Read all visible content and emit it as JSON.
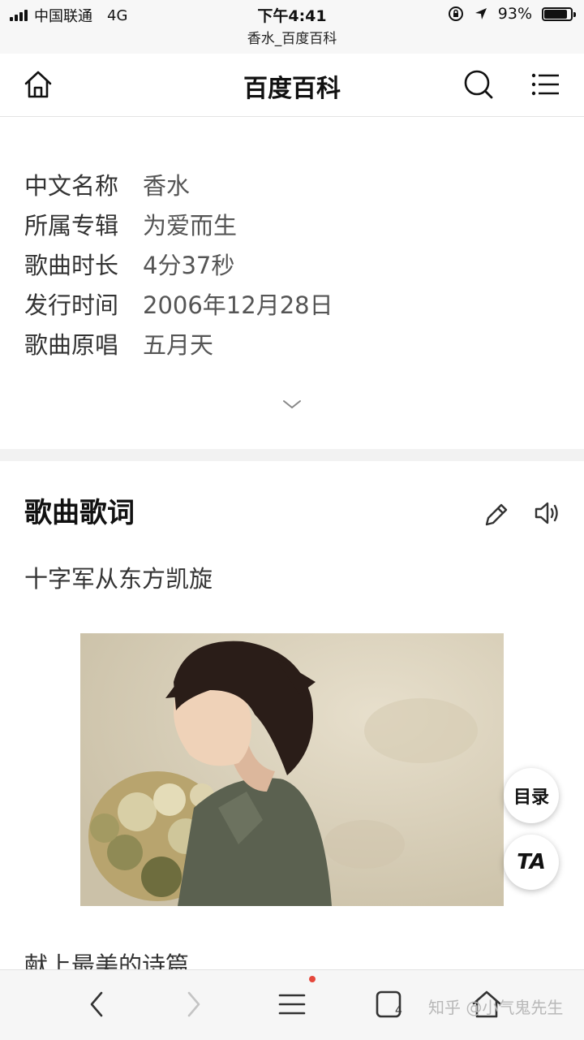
{
  "status_bar": {
    "carrier": "中国联通",
    "network": "4G",
    "time": "下午4:41",
    "page_subtitle": "香水_百度百科",
    "battery": "93%",
    "battery_level": 0.93
  },
  "header": {
    "home_icon": "home-icon",
    "title": "百度百科",
    "search_icon": "search-icon",
    "menu_icon": "menu-icon"
  },
  "info": {
    "rows": [
      {
        "label": "中文名称",
        "value": "香水"
      },
      {
        "label": "所属专辑",
        "value": "为爱而生"
      },
      {
        "label": "歌曲时长",
        "value": "4分37秒"
      },
      {
        "label": "发行时间",
        "value": "2006年12月28日"
      },
      {
        "label": "歌曲原唱",
        "value": "五月天"
      }
    ],
    "expand_icon": "chevron-down-icon"
  },
  "lyrics_section": {
    "title": "歌曲歌词",
    "edit_icon": "pencil-icon",
    "audio_icon": "speaker-icon",
    "line1": "十字军从东方凯旋",
    "line2": "献上最美的诗篇"
  },
  "floating": {
    "toc_label": "目录",
    "ta_label": "TA"
  },
  "toolbar": {
    "back_icon": "chevron-left-icon",
    "forward_icon": "chevron-right-icon",
    "menu_icon": "menu-icon",
    "tabs_icon": "tabs-icon",
    "tab_count": "4",
    "home_icon": "home-icon",
    "watermark": "知乎 @小气鬼先生"
  },
  "colors": {
    "notification_dot": "#e5473b",
    "divider": "#f2f2f2"
  }
}
